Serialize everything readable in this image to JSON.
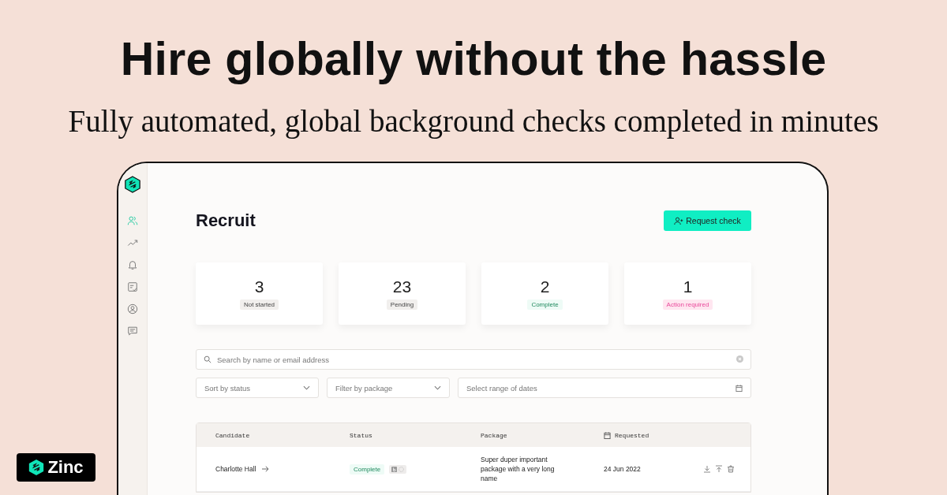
{
  "headline": "Hire globally without the hassle",
  "subheadline": "Fully automated, global background checks completed in minutes",
  "app": {
    "nav": [
      {
        "kind": "people",
        "selected": true
      },
      {
        "kind": "trend",
        "selected": false
      },
      {
        "kind": "bell",
        "selected": false
      },
      {
        "kind": "checklist",
        "selected": false
      },
      {
        "kind": "account",
        "selected": false
      },
      {
        "kind": "message",
        "selected": false
      }
    ],
    "title": "Recruit",
    "request_button": "Request check",
    "stats": [
      {
        "count": "3",
        "label": "Not started",
        "kind": "neutral"
      },
      {
        "count": "23",
        "label": "Pending",
        "kind": "neutral"
      },
      {
        "count": "2",
        "label": "Complete",
        "kind": "complete"
      },
      {
        "count": "1",
        "label": "Action required",
        "kind": "action"
      }
    ],
    "search": {
      "placeholder": "Search by name or email address"
    },
    "filters": [
      {
        "placeholder": "Sort by status",
        "kind": "dropdown"
      },
      {
        "placeholder": "Filter by package",
        "kind": "dropdown"
      },
      {
        "placeholder": "Select range of dates",
        "kind": "date"
      }
    ],
    "table": {
      "columns": [
        "Candidate",
        "Status",
        "Package",
        "Requested"
      ],
      "rows": [
        {
          "candidate": "Charlotte Hall",
          "status": "Complete",
          "kind": "complete",
          "package": "Super duper important package with a very long name",
          "requested": "24 Jun 2022"
        }
      ]
    }
  },
  "brand_badge": {
    "name": "Zinc"
  }
}
